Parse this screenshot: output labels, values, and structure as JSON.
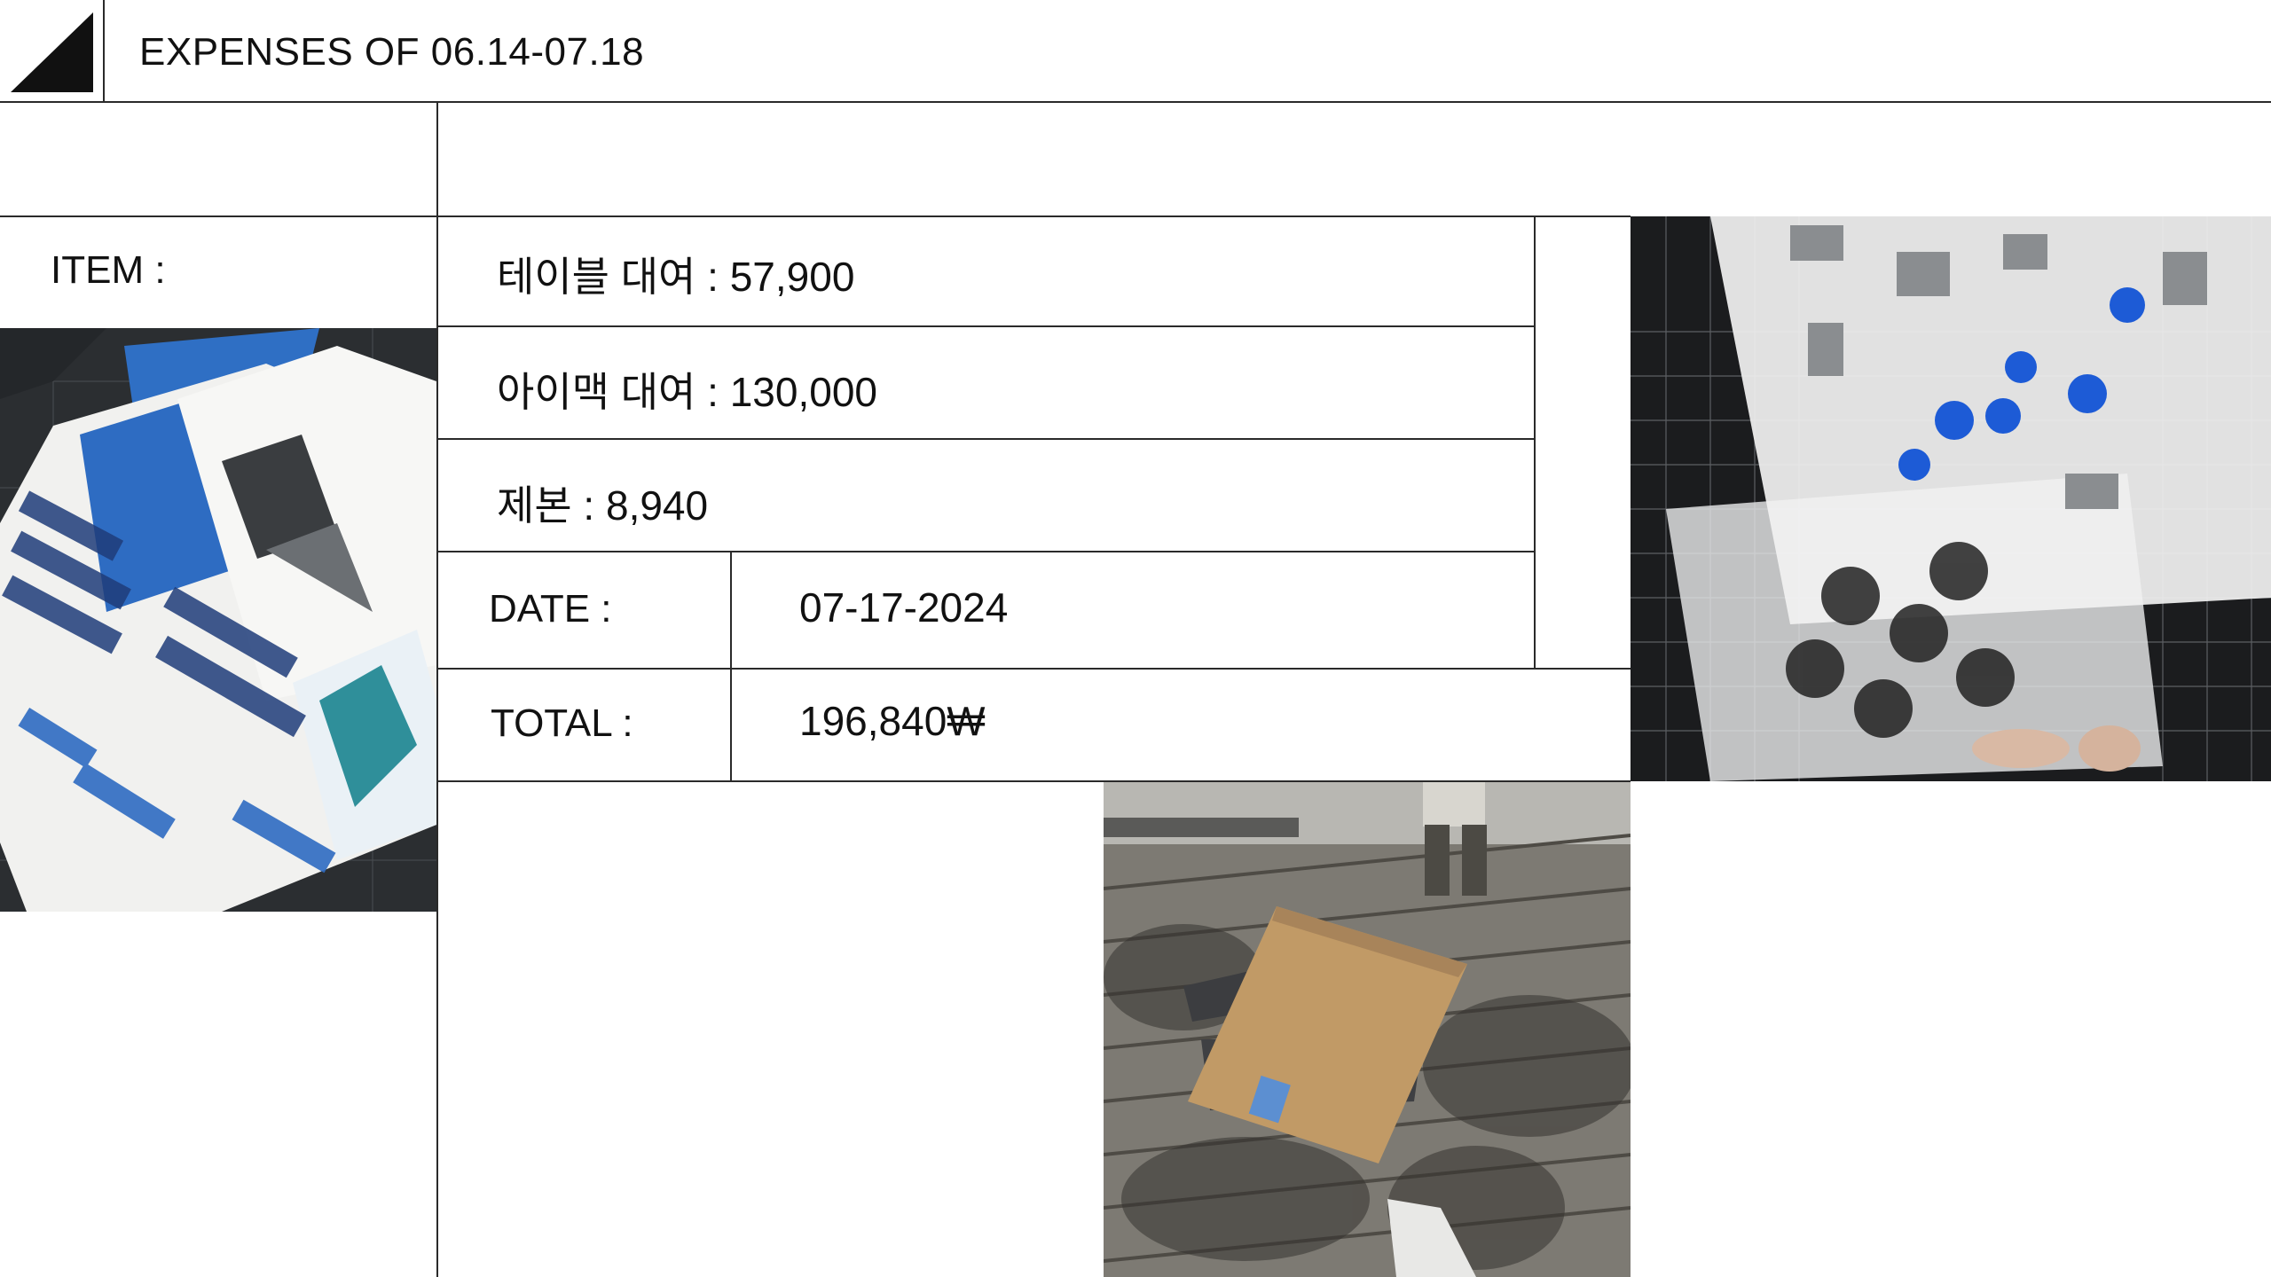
{
  "header": {
    "title": "EXPENSES OF 06.14-07.18"
  },
  "item": {
    "label": "ITEM :",
    "entries": [
      "테이블 대여 : 57,900",
      "아이맥 대여 : 130,000",
      "제본 : 8,940"
    ]
  },
  "date": {
    "label": "DATE :",
    "value": "07-17-2024"
  },
  "total": {
    "label": "TOTAL :",
    "value": "196,840₩"
  },
  "colors": {
    "line": "#2a2a2a",
    "background": "#ffffff",
    "text": "#111111"
  }
}
